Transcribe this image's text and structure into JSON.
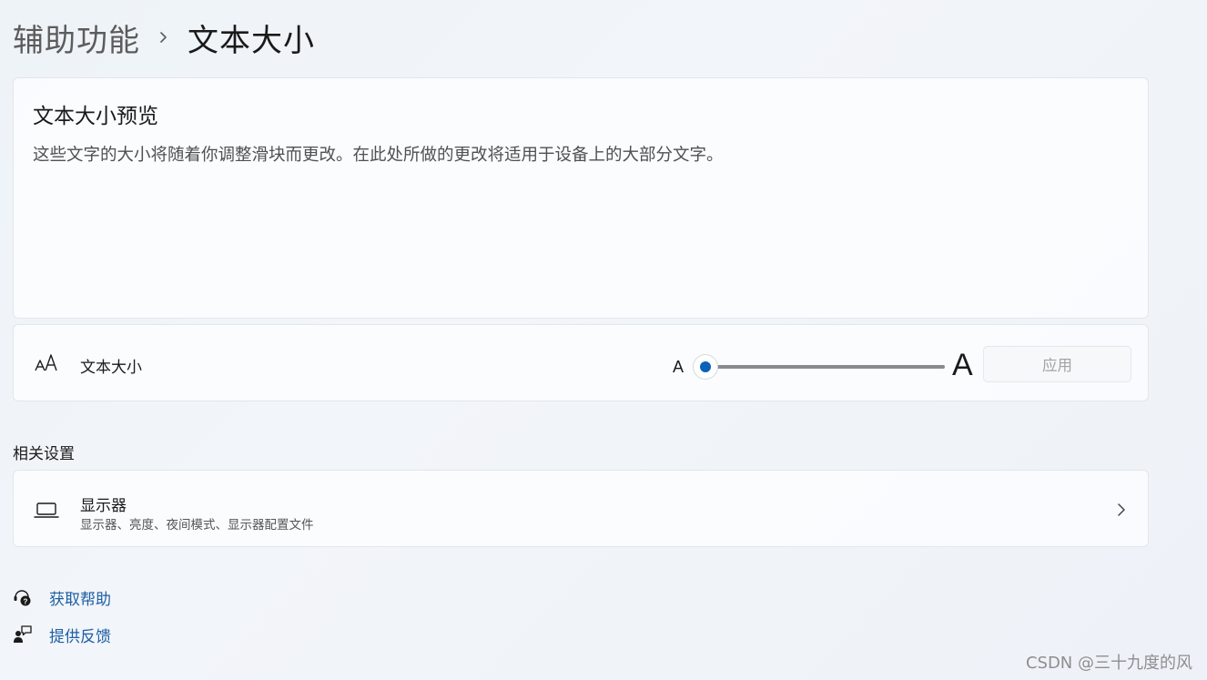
{
  "breadcrumb": {
    "parent": "辅助功能",
    "current": "文本大小"
  },
  "preview": {
    "title": "文本大小预览",
    "description": "这些文字的大小将随着你调整滑块而更改。在此处所做的更改将适用于设备上的大部分文字。"
  },
  "text_size": {
    "label": "文本大小",
    "small_a": "A",
    "large_a": "A",
    "slider_value_percent": 100,
    "slider_min_percent": 100,
    "slider_max_percent": 225,
    "apply_label": "应用",
    "apply_disabled": true,
    "icon": "text-size-icon"
  },
  "related": {
    "title": "相关设置",
    "items": [
      {
        "title": "显示器",
        "subtitle": "显示器、亮度、夜间模式、显示器配置文件",
        "icon": "laptop-display-icon"
      }
    ]
  },
  "links": {
    "help": "获取帮助",
    "feedback": "提供反馈"
  },
  "watermark": "CSDN @三十九度的风",
  "colors": {
    "accent": "#0a62b8",
    "link": "#1d5fa5",
    "background": "#eef3f8"
  }
}
